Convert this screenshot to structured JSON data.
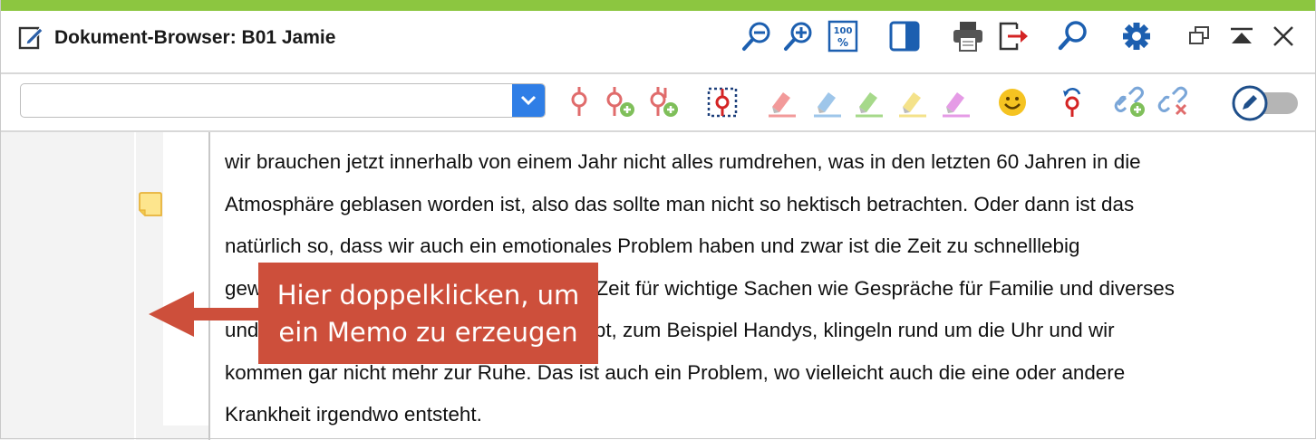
{
  "window": {
    "title": "Dokument-Browser: B01 Jamie",
    "accent_color": "#8cc640",
    "icons": [
      "edit-document-icon",
      "zoom-out-icon",
      "zoom-in-icon",
      "zoom-100-icon",
      "split-view-icon",
      "print-icon",
      "export-icon",
      "search-icon",
      "settings-icon",
      "restore-window-icon",
      "collapse-icon",
      "close-icon"
    ]
  },
  "toolbar": {
    "code_combo": {
      "value": "",
      "placeholder": ""
    },
    "icons": [
      "code-icon",
      "code-new-icon",
      "code-add-icon",
      "code-frame-icon",
      "highlight-red-icon",
      "highlight-blue-icon",
      "highlight-green-icon",
      "highlight-yellow-icon",
      "highlight-magenta-icon",
      "emoticode-icon",
      "undo-code-icon",
      "link-add-icon",
      "link-remove-icon",
      "edit-mode-toggle-icon"
    ],
    "edit_mode": false
  },
  "document": {
    "lines": [
      "wir brauchen jetzt innerhalb von einem Jahr nicht alles rumdrehen, was in den letzten 60 Jahren in die",
      "Atmosphäre geblasen worden ist, also das sollte man nicht so hektisch betrachten. Oder dann ist das",
      "natürlich so, dass wir auch ein emotionales Problem haben und zwar ist die Zeit zu schnelllebig",
      "geworden, es gibt also nicht mehr genug Zeit für wichtige Sachen wie Gespräche für Familie und diverses",
      "und dann diese Technik, die es jetzt so gibt, zum Beispiel Handys, klingeln rund um die Uhr und wir",
      "kommen gar nicht mehr zur Ruhe. Das ist auch ein Problem, wo vielleicht auch die eine oder andere",
      "Krankheit irgendwo entsteht."
    ],
    "memo_icon": "memo-note-icon"
  },
  "callout": {
    "line1": "Hier doppelklicken, um",
    "line2": "ein Memo zu erzeugen",
    "color": "#cd4f3b"
  }
}
